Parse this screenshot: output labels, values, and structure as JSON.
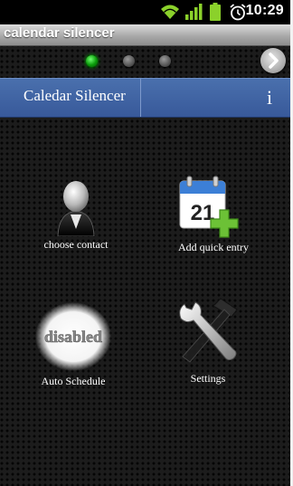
{
  "status_bar": {
    "time": "10:29",
    "icons": [
      "wifi-icon",
      "signal-icon",
      "battery-icon",
      "alarm-clock-icon"
    ],
    "signal_color": "#8bd12b",
    "battery_color": "#8bd12b"
  },
  "title_bar": {
    "title": "calendar silencer"
  },
  "pager": {
    "page_count": 3,
    "active_index": 0,
    "active_color": "#14c814"
  },
  "app_header": {
    "title": "Caledar Silencer",
    "info_label": "i",
    "background": "#3c5f9f"
  },
  "tiles": {
    "choose_contact": {
      "label": "choose contact",
      "icon": "contact-silhouette-icon"
    },
    "add_quick_entry": {
      "label": "Add quick entry",
      "icon": "calendar-add-icon",
      "calendar_day": "21"
    },
    "auto_schedule": {
      "label": "Auto Schedule",
      "icon": "disabled-badge-icon",
      "badge_text": "disabled"
    },
    "settings": {
      "label": "Settings",
      "icon": "wrench-hammer-icon"
    }
  }
}
